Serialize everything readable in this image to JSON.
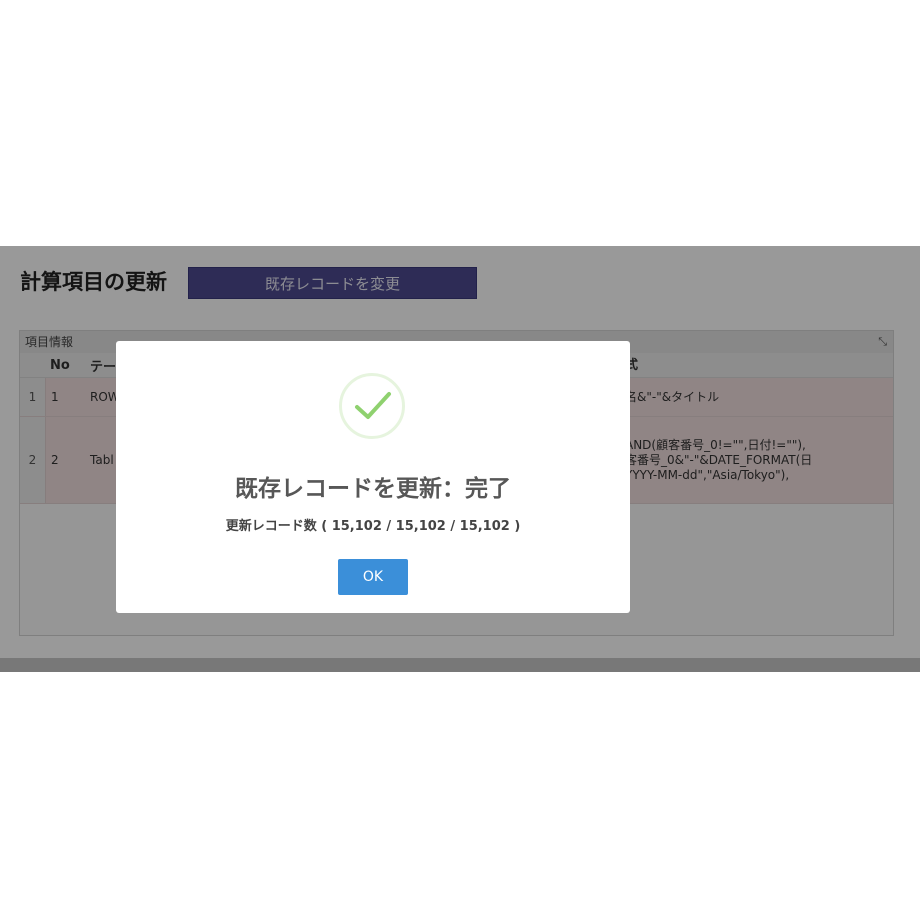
{
  "page": {
    "title": "計算項目の更新",
    "action_button": "既存レコードを変更"
  },
  "panel": {
    "title": "項目情報",
    "toggle_icon": "collapse-icon",
    "columns": [
      "No",
      "テー",
      "式"
    ],
    "rows": [
      {
        "index": "1",
        "no": "1",
        "table": "ROW",
        "formula": "名&\"-\"&タイトル"
      },
      {
        "index": "2",
        "no": "2",
        "table": "Tabl",
        "formula": "AND(顧客番号_0!=\"\",日付!=\"\"),\n客番号_0&\"-\"&DATE_FORMAT(日\nYYYY-MM-dd\",\"Asia/Tokyo\"),"
      }
    ]
  },
  "modal": {
    "icon": "success-check-icon",
    "title": "既存レコードを更新：完了",
    "message": "更新レコード数 ( 15,102 / 15,102 / 15,102 )",
    "ok_label": "OK"
  },
  "colors": {
    "accent": "#3b8fd9",
    "header_button": "#4d4a8f",
    "success": "#8fd16f",
    "row_highlight": "#f1dede"
  }
}
